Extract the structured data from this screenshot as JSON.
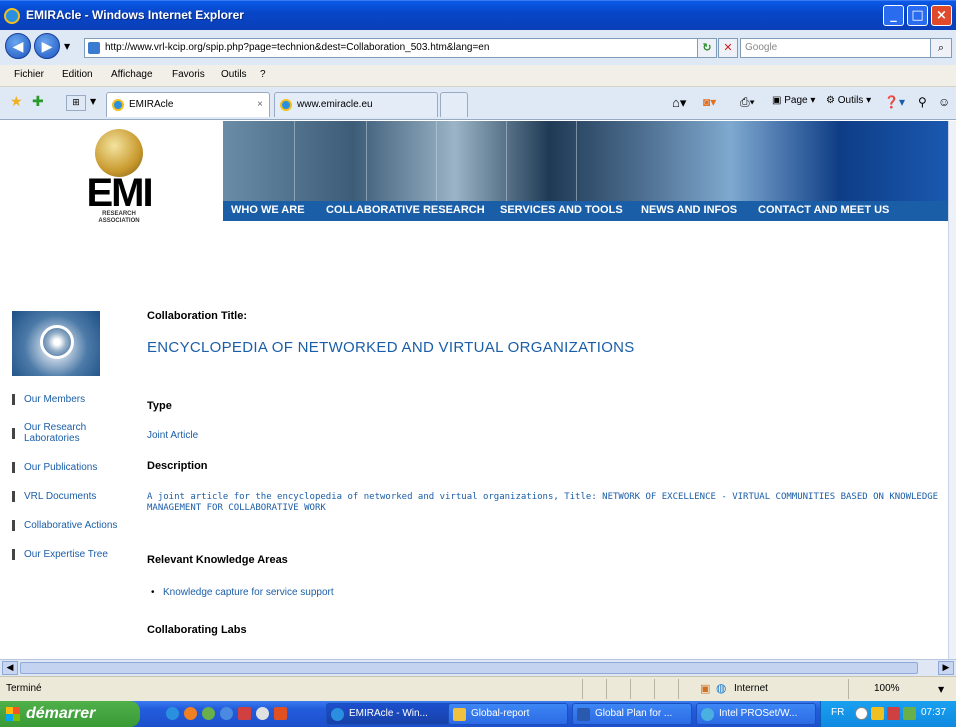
{
  "window": {
    "title": "EMIRAcle - Windows Internet Explorer"
  },
  "address": {
    "url": "http://www.vrl-kcip.org/spip.php?page=technion&dest=Collaboration_503.htm&lang=en"
  },
  "search": {
    "placeholder": "Google"
  },
  "menu": {
    "items": [
      "Fichier",
      "Edition",
      "Affichage",
      "Favoris",
      "Outils",
      "?"
    ]
  },
  "tabs": [
    {
      "label": "EMIRAcle"
    },
    {
      "label": "www.emiracle.eu"
    }
  ],
  "toolbar": {
    "page_label": "Page",
    "tools_label": "Outils"
  },
  "logo": {
    "text": "EMI",
    "sub": "RESEARCH ASSOCIATION"
  },
  "nav": [
    "WHO WE ARE",
    "COLLABORATIVE RESEARCH",
    "SERVICES AND TOOLS",
    "NEWS AND INFOS",
    "CONTACT AND MEET US"
  ],
  "sidebar": {
    "items": [
      "Our Members",
      "Our Research Laboratories",
      "Our Publications",
      "VRL Documents",
      "Collaborative Actions",
      "Our Expertise Tree"
    ]
  },
  "main": {
    "collab_label": "Collaboration Title:",
    "collab_title": "ENCYCLOPEDIA OF NETWORKED AND VIRTUAL ORGANIZATIONS",
    "type_label": "Type",
    "type_value": "Joint Article",
    "desc_label": "Description",
    "desc_value": "A joint article for the encyclopedia of networked and virtual organizations, Title: NETWORK OF EXCELLENCE - VIRTUAL COMMUNITIES BASED ON KNOWLEDGE MANAGEMENT FOR COLLABORATIVE WORK",
    "areas_label": "Relevant Knowledge Areas",
    "areas": [
      "Knowledge capture for service support"
    ],
    "labs_label": "Collaborating Labs"
  },
  "status": {
    "text": "Terminé",
    "zone": "Internet",
    "zoom": "100%"
  },
  "taskbar": {
    "start": "démarrer",
    "tasks": [
      "EMIRAcle - Win...",
      "Global-report",
      "Global Plan for ...",
      "Intel PROSet/W..."
    ],
    "lang": "FR",
    "clock": "07:37"
  }
}
